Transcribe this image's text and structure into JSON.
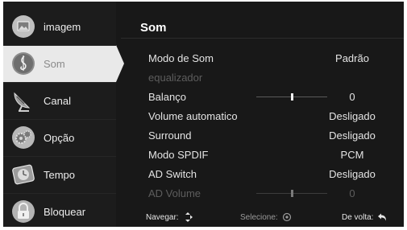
{
  "sidebar": {
    "items": [
      {
        "label": "imagem",
        "icon": "picture-icon",
        "active": false
      },
      {
        "label": "Som",
        "icon": "music-note-icon",
        "active": true
      },
      {
        "label": "Canal",
        "icon": "satellite-dish-icon",
        "active": false
      },
      {
        "label": "Opção",
        "icon": "gears-icon",
        "active": false
      },
      {
        "label": "Tempo",
        "icon": "clock-icon",
        "active": false
      },
      {
        "label": "Bloquear",
        "icon": "padlock-icon",
        "active": false
      }
    ]
  },
  "main": {
    "title": "Som",
    "rows": [
      {
        "label": "Modo de Som",
        "value": "Padrão",
        "enabled": true
      },
      {
        "label": "equalizador",
        "value": "",
        "enabled": false
      },
      {
        "label": "Balanço",
        "value": "0",
        "enabled": true,
        "slider_fraction": 0.5
      },
      {
        "label": "Volume automatico",
        "value": "Desligado",
        "enabled": true
      },
      {
        "label": "Surround",
        "value": "Desligado",
        "enabled": true
      },
      {
        "label": "Modo SPDIF",
        "value": "PCM",
        "enabled": true
      },
      {
        "label": "AD Switch",
        "value": "Desligado",
        "enabled": true
      },
      {
        "label": "AD Volume",
        "value": "0",
        "enabled": false,
        "slider_fraction": 0.5
      }
    ]
  },
  "footer": {
    "navigate": "Navegar:",
    "select": "Selecione:",
    "back": "De volta:"
  },
  "colors": {
    "background": "#181818",
    "sidebar_active": "#e9e9e9",
    "text": "#e4e4e4",
    "disabled_text": "#5d5d5d"
  }
}
